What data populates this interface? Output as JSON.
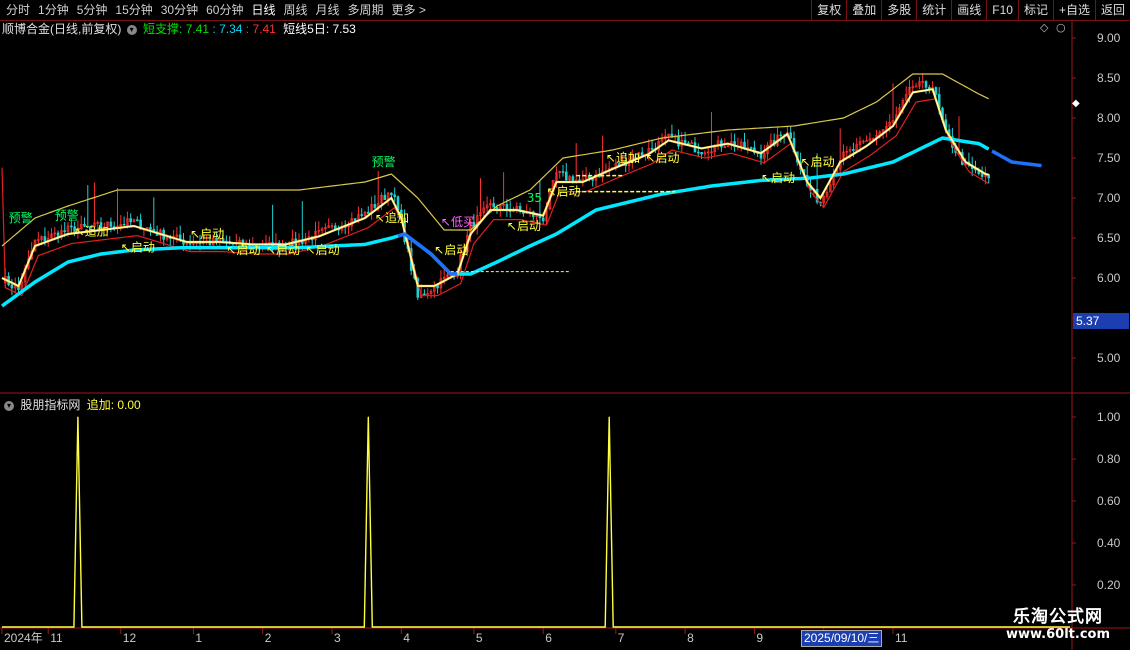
{
  "toolbar": {
    "periods": [
      "分时",
      "1分钟",
      "5分钟",
      "15分钟",
      "30分钟",
      "60分钟",
      "日线",
      "周线",
      "月线",
      "多周期",
      "更多 >"
    ],
    "active_period": "日线",
    "right_buttons": [
      "复权",
      "叠加",
      "多股",
      "统计",
      "画线",
      "F10",
      "标记",
      "+自选",
      "返回"
    ]
  },
  "main_title": {
    "name": "顺博合金(日线,前复权)",
    "indicator": "短支撑:",
    "v1": "7.41",
    "v2": ": 7.34",
    "v3": ": 7.41",
    "short5": "短线5日: 7.53",
    "colors": {
      "name": "#e0e0e0",
      "indicator": "#00e000",
      "v1": "#00e000",
      "v2": "#00d8ff",
      "v3": "#ff3030",
      "short5": "#ffffff"
    }
  },
  "indicator_title": {
    "name": "股朋指标网",
    "label": "追加: 0.00",
    "colors": {
      "name": "#e0e0e0",
      "label": "#ffff40"
    }
  },
  "price_tag": "5.37",
  "date_box": "2025/09/10/三",
  "watermark": {
    "line1": "乐淘公式网",
    "line2": "www.60lt.com"
  },
  "chart_data": [
    {
      "type": "line",
      "panel": "main",
      "title": "",
      "ylim": [
        4.6,
        9.2
      ],
      "y_ticks": [
        "9.00",
        "8.50",
        "8.00",
        "7.50",
        "7.00",
        "6.50",
        "6.00",
        "5.50",
        "5.00"
      ],
      "y_tick_values": [
        9.0,
        8.5,
        8.0,
        7.5,
        7.0,
        6.5,
        6.0,
        5.5,
        5.0
      ],
      "x_labels": [
        "2024年",
        "11",
        "12",
        "1",
        "2",
        "3",
        "4",
        "5",
        "6",
        "7",
        "8",
        "9",
        "10",
        "11"
      ],
      "x_label_positions": [
        0,
        14,
        36,
        58,
        79,
        100,
        121,
        143,
        164,
        186,
        207,
        228,
        249,
        270
      ],
      "n_bars": 300,
      "close_keyframes": [
        [
          0,
          6.0
        ],
        [
          5,
          5.85
        ],
        [
          10,
          6.45
        ],
        [
          20,
          6.6
        ],
        [
          30,
          6.65
        ],
        [
          40,
          6.7
        ],
        [
          48,
          6.55
        ],
        [
          56,
          6.45
        ],
        [
          66,
          6.45
        ],
        [
          76,
          6.4
        ],
        [
          86,
          6.4
        ],
        [
          96,
          6.55
        ],
        [
          110,
          6.8
        ],
        [
          118,
          7.1
        ],
        [
          121,
          6.7
        ],
        [
          126,
          5.75
        ],
        [
          131,
          5.9
        ],
        [
          138,
          6.1
        ],
        [
          142,
          6.65
        ],
        [
          148,
          6.9
        ],
        [
          156,
          6.85
        ],
        [
          164,
          6.75
        ],
        [
          168,
          7.3
        ],
        [
          176,
          7.2
        ],
        [
          186,
          7.4
        ],
        [
          196,
          7.6
        ],
        [
          202,
          7.75
        ],
        [
          212,
          7.6
        ],
        [
          220,
          7.7
        ],
        [
          230,
          7.55
        ],
        [
          238,
          7.85
        ],
        [
          244,
          7.15
        ],
        [
          248,
          6.95
        ],
        [
          254,
          7.5
        ],
        [
          262,
          7.7
        ],
        [
          270,
          7.95
        ],
        [
          276,
          8.4
        ],
        [
          282,
          8.4
        ],
        [
          286,
          7.8
        ],
        [
          292,
          7.4
        ],
        [
          298,
          7.25
        ],
        [
          306,
          7.2
        ],
        [
          314,
          7.3
        ],
        [
          320,
          7.5
        ],
        [
          324,
          7.5
        ]
      ],
      "series": [
        {
          "name": "短线5日",
          "color": "#ffffff",
          "keyframes": [
            [
              0,
              6.0
            ],
            [
              5,
              5.9
            ],
            [
              10,
              6.4
            ],
            [
              20,
              6.55
            ],
            [
              30,
              6.6
            ],
            [
              40,
              6.65
            ],
            [
              48,
              6.55
            ],
            [
              56,
              6.45
            ],
            [
              66,
              6.45
            ],
            [
              76,
              6.42
            ],
            [
              86,
              6.42
            ],
            [
              96,
              6.52
            ],
            [
              110,
              6.75
            ],
            [
              118,
              7.0
            ],
            [
              121,
              6.75
            ],
            [
              126,
              5.9
            ],
            [
              131,
              5.9
            ],
            [
              138,
              6.05
            ],
            [
              142,
              6.55
            ],
            [
              148,
              6.85
            ],
            [
              156,
              6.85
            ],
            [
              164,
              6.78
            ],
            [
              168,
              7.2
            ],
            [
              176,
              7.2
            ],
            [
              186,
              7.38
            ],
            [
              196,
              7.55
            ],
            [
              202,
              7.72
            ],
            [
              212,
              7.62
            ],
            [
              220,
              7.68
            ],
            [
              230,
              7.56
            ],
            [
              238,
              7.8
            ],
            [
              244,
              7.2
            ],
            [
              248,
              7.0
            ],
            [
              254,
              7.45
            ],
            [
              262,
              7.65
            ],
            [
              270,
              7.9
            ],
            [
              276,
              8.32
            ],
            [
              282,
              8.36
            ],
            [
              286,
              7.85
            ],
            [
              292,
              7.45
            ],
            [
              298,
              7.3
            ],
            [
              306,
              7.22
            ],
            [
              314,
              7.32
            ],
            [
              320,
              7.48
            ],
            [
              324,
              7.5
            ]
          ]
        },
        {
          "name": "短支撑",
          "color": "#00e8ff",
          "keyframes": [
            [
              0,
              5.65
            ],
            [
              10,
              5.95
            ],
            [
              20,
              6.2
            ],
            [
              30,
              6.3
            ],
            [
              40,
              6.35
            ],
            [
              55,
              6.38
            ],
            [
              70,
              6.38
            ],
            [
              90,
              6.38
            ],
            [
              110,
              6.42
            ],
            [
              118,
              6.5
            ],
            [
              122,
              6.55
            ],
            [
              130,
              6.3
            ],
            [
              136,
              6.05
            ],
            [
              142,
              6.05
            ],
            [
              150,
              6.2
            ],
            [
              160,
              6.4
            ],
            [
              168,
              6.55
            ],
            [
              180,
              6.85
            ],
            [
              200,
              7.05
            ],
            [
              215,
              7.15
            ],
            [
              230,
              7.22
            ],
            [
              245,
              7.25
            ],
            [
              255,
              7.3
            ],
            [
              270,
              7.45
            ],
            [
              285,
              7.75
            ],
            [
              296,
              7.68
            ],
            [
              306,
              7.45
            ],
            [
              316,
              7.4
            ],
            [
              324,
              7.36
            ]
          ]
        },
        {
          "name": "upper",
          "color": "#d8c848",
          "keyframes": [
            [
              0,
              6.4
            ],
            [
              10,
              6.75
            ],
            [
              20,
              6.9
            ],
            [
              35,
              7.1
            ],
            [
              50,
              7.1
            ],
            [
              70,
              7.1
            ],
            [
              90,
              7.1
            ],
            [
              110,
              7.2
            ],
            [
              118,
              7.3
            ],
            [
              126,
              7.0
            ],
            [
              134,
              6.6
            ],
            [
              142,
              6.6
            ],
            [
              150,
              6.9
            ],
            [
              160,
              7.1
            ],
            [
              170,
              7.5
            ],
            [
              185,
              7.6
            ],
            [
              200,
              7.75
            ],
            [
              220,
              7.85
            ],
            [
              240,
              7.9
            ],
            [
              255,
              8.0
            ],
            [
              265,
              8.2
            ],
            [
              276,
              8.55
            ],
            [
              285,
              8.55
            ],
            [
              296,
              8.3
            ],
            [
              306,
              8.1
            ],
            [
              324,
              8.1
            ]
          ]
        }
      ],
      "annotations": [
        {
          "text": "预警",
          "x": 2,
          "y": 6.7,
          "color": "#00ff60"
        },
        {
          "text": "预警",
          "x": 16,
          "y": 6.73,
          "color": "#00ff60"
        },
        {
          "text": "↖追加",
          "x": 22,
          "y": 6.53,
          "color": "#ffff40"
        },
        {
          "text": "↖启动",
          "x": 36,
          "y": 6.33,
          "color": "#ffff40"
        },
        {
          "text": "↖启动",
          "x": 57,
          "y": 6.5,
          "color": "#ffff40"
        },
        {
          "text": "↖启动",
          "x": 68,
          "y": 6.3,
          "color": "#ffff40"
        },
        {
          "text": "↖启动",
          "x": 80,
          "y": 6.3,
          "color": "#ffff40"
        },
        {
          "text": "↖启动",
          "x": 92,
          "y": 6.3,
          "color": "#ffff40"
        },
        {
          "text": "预警",
          "x": 112,
          "y": 7.4,
          "color": "#00ff60"
        },
        {
          "text": "↖追加",
          "x": 113,
          "y": 6.7,
          "color": "#ffff40"
        },
        {
          "text": "↖低买",
          "x": 133,
          "y": 6.65,
          "color": "#ff60ff"
        },
        {
          "text": "↖启动",
          "x": 131,
          "y": 6.3,
          "color": "#ffff40"
        },
        {
          "text": "↖启动",
          "x": 153,
          "y": 6.6,
          "color": "#ffff40"
        },
        {
          "text": "35",
          "x": 159,
          "y": 6.95,
          "color": "#00ff60"
        },
        {
          "text": "↖启动",
          "x": 165,
          "y": 7.03,
          "color": "#ffff40"
        },
        {
          "text": "↖追加",
          "x": 183,
          "y": 7.45,
          "color": "#ffff40"
        },
        {
          "text": "↖启动",
          "x": 195,
          "y": 7.45,
          "color": "#ffff40"
        },
        {
          "text": "↖启动",
          "x": 230,
          "y": 7.2,
          "color": "#ffff40"
        },
        {
          "text": "↖启动",
          "x": 242,
          "y": 7.4,
          "color": "#ffff40"
        }
      ]
    },
    {
      "type": "line",
      "panel": "indicator",
      "title": "",
      "ylim": [
        0,
        1.08
      ],
      "y_ticks": [
        "1.00",
        "0.80",
        "0.60",
        "0.40",
        "0.20"
      ],
      "y_tick_values": [
        1.0,
        0.8,
        0.6,
        0.4,
        0.2
      ],
      "series": [
        {
          "name": "追加",
          "color": "#ffff40",
          "spikes": [
            23,
            111,
            184
          ],
          "value": 1.0
        }
      ]
    }
  ]
}
